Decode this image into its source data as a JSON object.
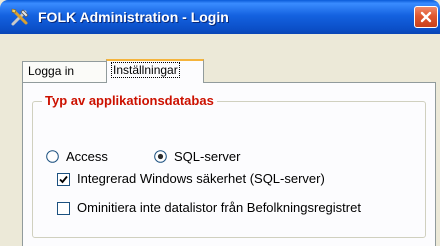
{
  "window": {
    "title": "FOLK Administration - Login",
    "icon": "tools-icon",
    "accent_color": "#0a5bd8"
  },
  "tabs": [
    {
      "label": "Logga in",
      "active": false
    },
    {
      "label": "Inställningar",
      "active": true
    }
  ],
  "group": {
    "title": "Typ av applikationsdatabas",
    "title_color": "#cc1100"
  },
  "db_type": {
    "options": [
      {
        "label": "Access",
        "selected": false
      },
      {
        "label": "SQL-server",
        "selected": true
      }
    ]
  },
  "options": {
    "integrated_security": {
      "label": "Integrerad Windows säkerhet (SQL-server)",
      "checked": true
    },
    "no_init_lists": {
      "label": "Ominitiera inte datalistor från Befolkningsregistret",
      "checked": false
    }
  }
}
